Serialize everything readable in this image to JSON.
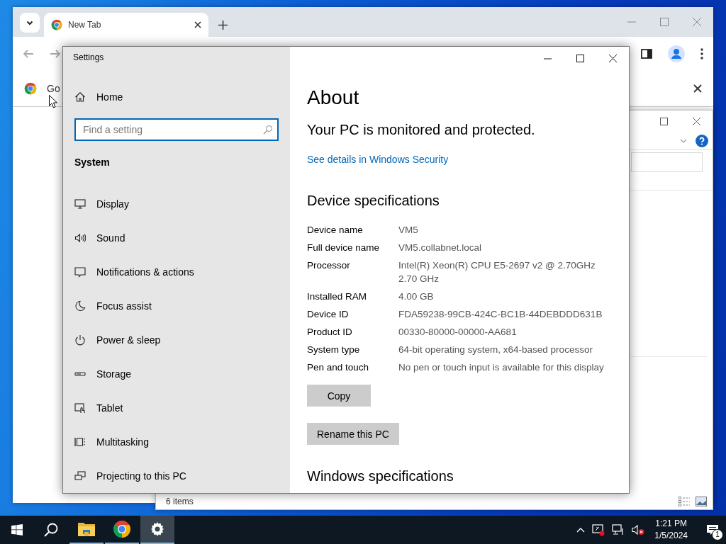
{
  "browser": {
    "tabs": [
      {
        "label": "New Tab",
        "selected": true
      }
    ],
    "infobar_text": "Go"
  },
  "explorer": {
    "status_text": "6 items"
  },
  "settings": {
    "window_title": "Settings",
    "home_label": "Home",
    "search": {
      "placeholder": "Find a setting"
    },
    "section_title": "System",
    "nav_items": [
      {
        "label": "Display",
        "kind": "display"
      },
      {
        "label": "Sound",
        "kind": "sound"
      },
      {
        "label": "Notifications & actions",
        "kind": "notifications"
      },
      {
        "label": "Focus assist",
        "kind": "focus"
      },
      {
        "label": "Power & sleep",
        "kind": "power"
      },
      {
        "label": "Storage",
        "kind": "storage"
      },
      {
        "label": "Tablet",
        "kind": "tablet"
      },
      {
        "label": "Multitasking",
        "kind": "multitasking"
      },
      {
        "label": "Projecting to this PC",
        "kind": "projecting"
      }
    ],
    "page_title": "About",
    "protection_status": "Your PC is monitored and protected.",
    "security_link": "See details in Windows Security",
    "device_heading": "Device specifications",
    "specs": [
      {
        "label": "Device name",
        "lines": [
          "VM5"
        ]
      },
      {
        "label": "Full device name",
        "lines": [
          "VM5.collabnet.local"
        ]
      },
      {
        "label": "Processor",
        "lines": [
          "Intel(R) Xeon(R) CPU E5-2697 v2 @ 2.70GHz",
          "2.70 GHz"
        ]
      },
      {
        "label": "Installed RAM",
        "lines": [
          "4.00 GB"
        ]
      },
      {
        "label": "Device ID",
        "lines": [
          "FDA59238-99CB-424C-BC1B-44DEBDDD631B"
        ]
      },
      {
        "label": "Product ID",
        "lines": [
          "00330-80000-00000-AA681"
        ]
      },
      {
        "label": "System type",
        "lines": [
          "64-bit operating system, x64-based processor"
        ]
      },
      {
        "label": "Pen and touch",
        "lines": [
          "No pen or touch input is available for this display"
        ]
      }
    ],
    "buttons": [
      "Copy",
      "Rename this PC"
    ],
    "windows_heading": "Windows specifications"
  },
  "taskbar": {
    "apps": [
      {
        "kind": "explorer",
        "selected": false
      },
      {
        "kind": "chrome",
        "selected": false
      },
      {
        "kind": "settings",
        "selected": true
      }
    ],
    "time": "1:21 PM",
    "date": "1/5/2024",
    "notification_count": "1"
  }
}
